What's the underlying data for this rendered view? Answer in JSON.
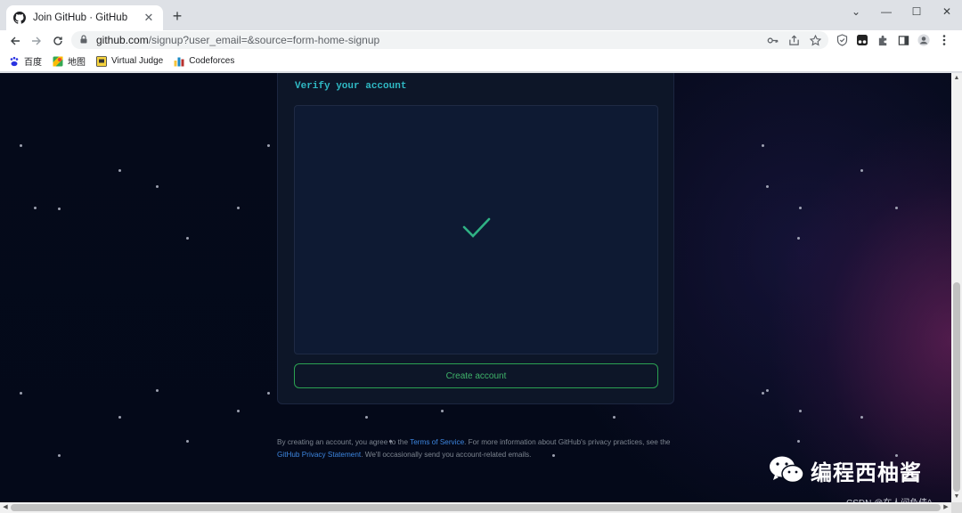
{
  "browser": {
    "tab_title": "Join GitHub · GitHub",
    "tab_close": "✕",
    "new_tab": "+",
    "url_host": "github.com",
    "url_path": "/signup?user_email=&source=form-home-signup",
    "window_controls": {
      "chevron": "⌄",
      "minimize": "—",
      "maximize": "☐",
      "close": "✕"
    }
  },
  "bookmarks": [
    {
      "label": "百度",
      "icon": "baidu-icon"
    },
    {
      "label": "地图",
      "icon": "maps-icon"
    },
    {
      "label": "Virtual Judge",
      "icon": "vjudge-icon"
    },
    {
      "label": "Codeforces",
      "icon": "codeforces-icon"
    }
  ],
  "signup": {
    "verify_title": "Verify your account",
    "create_button": "Create account",
    "legal": {
      "part1": "By creating an account, you agree to the ",
      "terms_link": "Terms of Service",
      "part2": ". For more information about GitHub's privacy practices, see the ",
      "privacy_link": "GitHub Privacy Statement",
      "part3": ". We'll occasionally send you account-related emails."
    }
  },
  "overlay": {
    "watermark": "编程西柚酱",
    "csdn": "CSDN @在人间负债^"
  },
  "colors": {
    "accent_cyan": "#2fb9c4",
    "button_green": "#2ba152",
    "link_blue": "#3d86e0",
    "page_bg": "#040919"
  }
}
